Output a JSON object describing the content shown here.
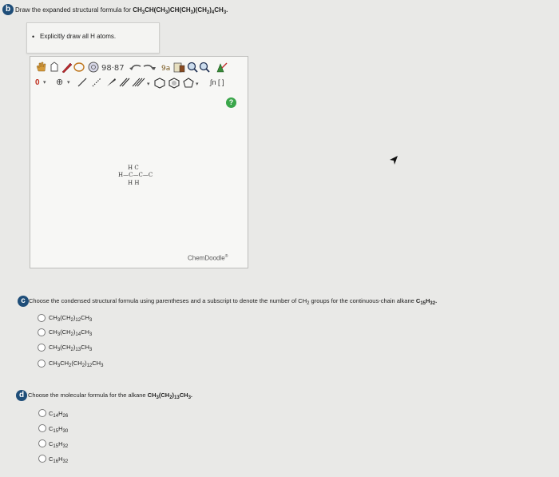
{
  "part_b": {
    "badge": "b",
    "prompt": "Draw the expanded structural formula for ",
    "formula_parts": [
      "CH",
      "3",
      "CH(CH",
      "3",
      ")CH(CH",
      "3",
      ")(CH",
      "2",
      ")",
      "4",
      "CH",
      "3",
      "."
    ],
    "instruction": "Explicitly draw all H atoms."
  },
  "editor": {
    "toolbar_row1": [
      "hand-tool-icon",
      "eraser-icon",
      "pencil-icon",
      "lasso-icon",
      "ring-icon",
      "undo-icon",
      "redo-icon",
      "template-icon",
      "zoom-in-icon",
      "zoom-out-icon",
      "clean-icon"
    ],
    "toolbar_row2_left": "0",
    "toolbar_row2_plus": "⊕",
    "bracket_tool": "∫n [ ]",
    "help": "?",
    "structure": {
      "row_top": "H   C",
      "row_mid": "H—C—C—C",
      "row_bot": "H   H"
    },
    "watermark": "ChemDoodle",
    "watermark_mark": "®"
  },
  "part_c": {
    "badge": "c",
    "prompt_start": "Choose the condensed structural formula using parentheses and a subscript to denote the number of CH",
    "prompt_sub": "2",
    "prompt_mid": " groups for the continuous-chain alkane ",
    "prompt_formula": [
      "C",
      "15",
      "H",
      "32",
      "."
    ],
    "options": [
      [
        "CH",
        "3",
        "(CH",
        "2",
        ")",
        "12",
        "CH",
        "3"
      ],
      [
        "CH",
        "3",
        "(CH",
        "2",
        ")",
        "14",
        "CH",
        "3"
      ],
      [
        "CH",
        "3",
        "(CH",
        "2",
        ")",
        "13",
        "CH",
        "3"
      ],
      [
        "CH",
        "3",
        "CH",
        "2",
        "(CH",
        "2",
        ")",
        "12",
        "CH",
        "3"
      ]
    ]
  },
  "part_d": {
    "badge": "d",
    "prompt_start": "Choose the molecular formula for the alkane ",
    "prompt_formula": [
      "CH",
      "3",
      "(CH",
      "2",
      ")",
      "13",
      "CH",
      "3",
      "."
    ],
    "options": [
      [
        "C",
        "14",
        "H",
        "26"
      ],
      [
        "C",
        "15",
        "H",
        "30"
      ],
      [
        "C",
        "15",
        "H",
        "32"
      ],
      [
        "C",
        "16",
        "H",
        "32"
      ]
    ]
  }
}
